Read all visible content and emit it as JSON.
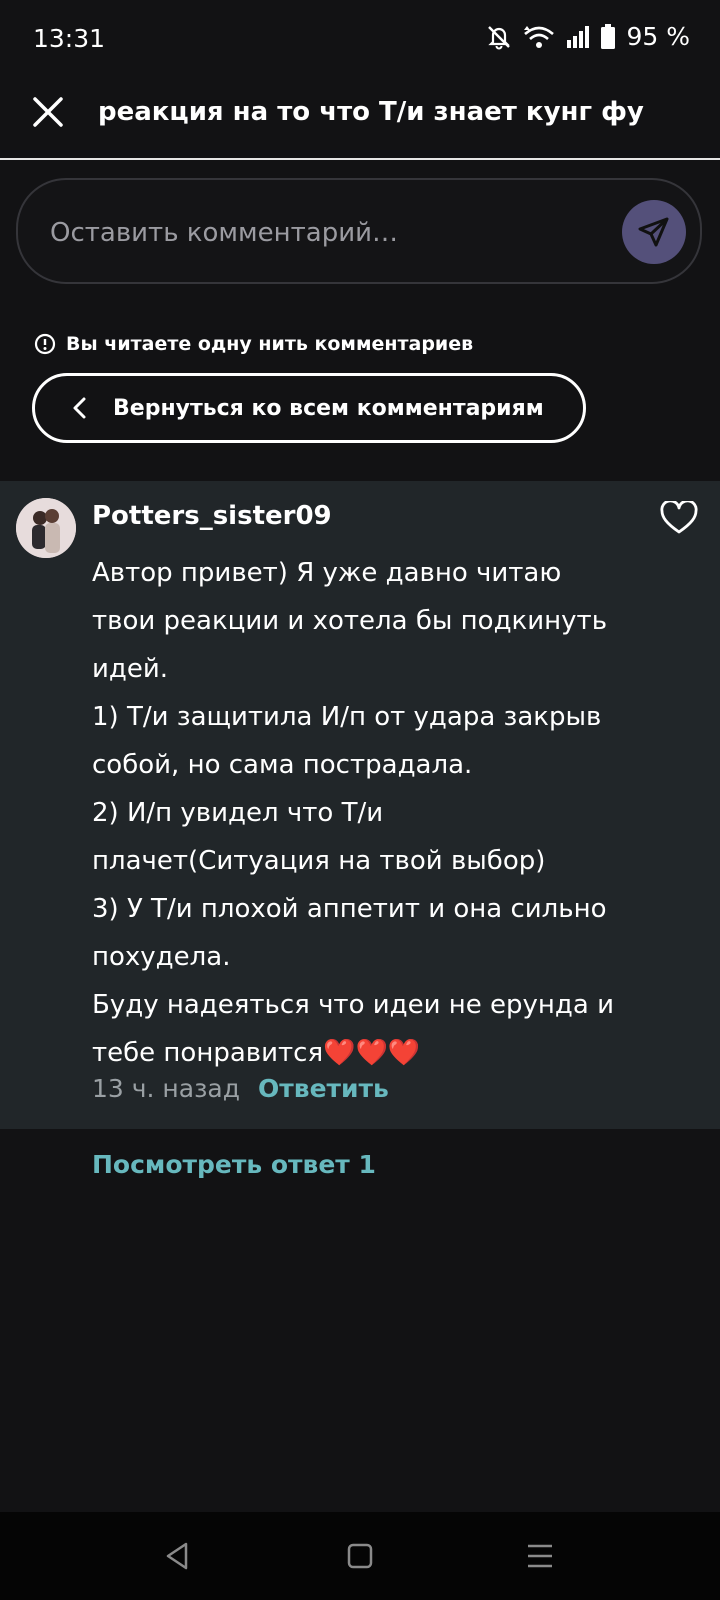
{
  "status": {
    "time": "13:31",
    "battery": "95 %",
    "icons": [
      "mute-bell-icon",
      "wifi-icon",
      "signal-icon",
      "battery-icon"
    ]
  },
  "header": {
    "title": "реакция на то что Т/и знает кунг фу",
    "close_icon": "close-icon"
  },
  "comment_input": {
    "placeholder": "Оставить комментарий…",
    "value": "",
    "send_icon": "send-icon"
  },
  "thread_notice": {
    "text": "Вы читаете одну нить комментариев",
    "icon": "info-icon"
  },
  "back_button": {
    "label": "Вернуться ко всем комментариям"
  },
  "comment": {
    "username": "Potters_sister09",
    "lines": [
      "Автор привет) Я уже давно читаю",
      "твои реакции и хотела бы подкинуть",
      "идей.",
      "1) Т/и защитила И/п от удара закрыв",
      "собой, но сама пострадала.",
      "2)  И/п увидел что Т/и",
      "плачет(Ситуация на твой выбор)",
      "3)  У Т/и плохой аппетит и она сильно",
      "похудела.",
      "Буду надеяться что идеи не ерунда и",
      "тебе понравится❤️❤️❤️"
    ],
    "time_ago": "13 ч. назад",
    "reply_label": "Ответить",
    "liked": false
  },
  "view_replies": "Посмотреть ответ 1",
  "colors": {
    "background": "#121214",
    "card": "#212629",
    "accent": "#67b8be",
    "send_button": "#54507a"
  }
}
